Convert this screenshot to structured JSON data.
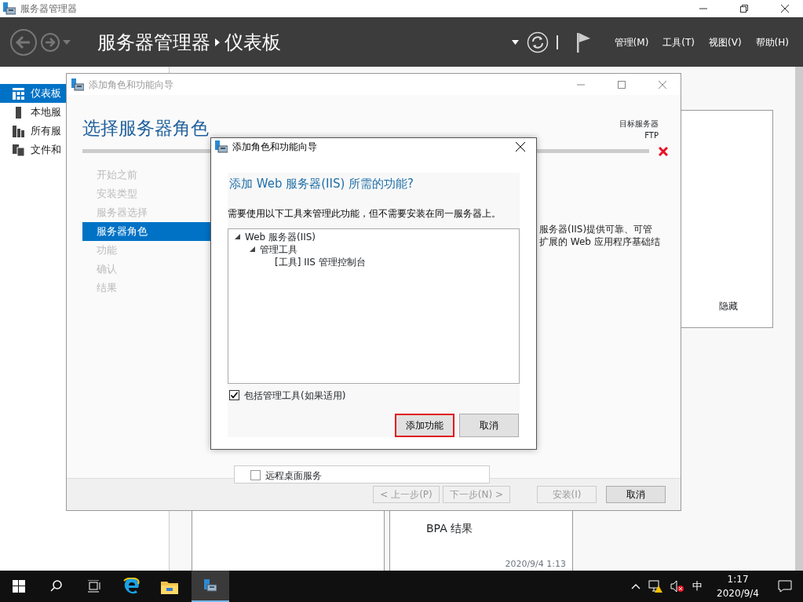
{
  "app": {
    "title": "服务器管理器",
    "breadcrumb": [
      "服务器管理器",
      "仪表板"
    ],
    "menus": [
      "管理(M)",
      "工具(T)",
      "视图(V)",
      "帮助(H)"
    ]
  },
  "nav": [
    {
      "label": "仪表板",
      "selected": true
    },
    {
      "label": "本地服",
      "selected": false
    },
    {
      "label": "所有服",
      "selected": false
    },
    {
      "label": "文件和",
      "selected": false
    }
  ],
  "welcome": {
    "hide": "隐藏"
  },
  "tiles": [
    {
      "title": "BPA 结果",
      "time": "2020/9/4 1:13"
    }
  ],
  "wizard": {
    "title": "添加角色和功能向导",
    "heading": "选择服务器角色",
    "target_label": "目标服务器",
    "target": "FTP",
    "steps": [
      {
        "label": "开始之前",
        "selected": false
      },
      {
        "label": "安装类型",
        "selected": false
      },
      {
        "label": "服务器选择",
        "selected": false
      },
      {
        "label": "服务器角色",
        "selected": true
      },
      {
        "label": "功能",
        "selected": false
      },
      {
        "label": "确认",
        "selected": false
      },
      {
        "label": "结果",
        "selected": false
      }
    ],
    "description": [
      "服务器(IIS)提供可靠、可管",
      "扩展的 Web 应用程序基础结"
    ],
    "role_row": {
      "label": "远程桌面服务",
      "checked": false
    },
    "buttons": [
      {
        "label": "< 上一步(P)",
        "disabled": true
      },
      {
        "label": "下一步(N) >",
        "disabled": true
      },
      {
        "label": "安装(I)",
        "disabled": true
      },
      {
        "label": "取消",
        "disabled": false
      }
    ]
  },
  "dialog": {
    "title": "添加角色和功能向导",
    "heading": "添加 Web 服务器(IIS) 所需的功能?",
    "text": "需要使用以下工具来管理此功能，但不需要安装在同一服务器上。",
    "tree": [
      {
        "label": "Web 服务器(IIS)",
        "expanded": true,
        "children": [
          {
            "label": "管理工具",
            "expanded": true,
            "children": [
              {
                "label": "[工具] IIS 管理控制台"
              }
            ]
          }
        ]
      }
    ],
    "include": {
      "label": "包括管理工具(如果适用)",
      "checked": true
    },
    "buttons": [
      {
        "label": "添加功能",
        "highlighted": true
      },
      {
        "label": "取消",
        "highlighted": false
      }
    ]
  },
  "taskbar": {
    "input_method": "中",
    "time": "1:17",
    "date": "2020/9/4"
  }
}
